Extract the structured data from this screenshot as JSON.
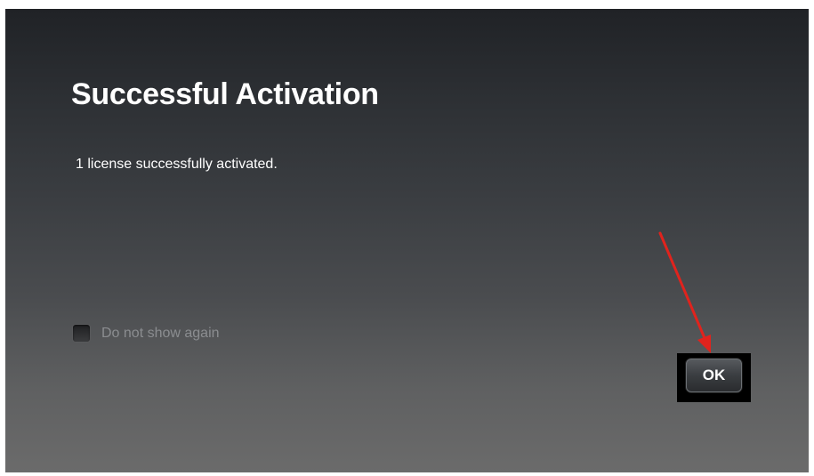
{
  "dialog": {
    "title": "Successful Activation",
    "message": "1 license successfully activated.",
    "dont_show_again_label": "Do not show again",
    "dont_show_again_checked": false,
    "ok_label": "OK"
  },
  "annotation": {
    "type": "arrow",
    "color": "#e0231d",
    "points_to": "ok-button"
  }
}
